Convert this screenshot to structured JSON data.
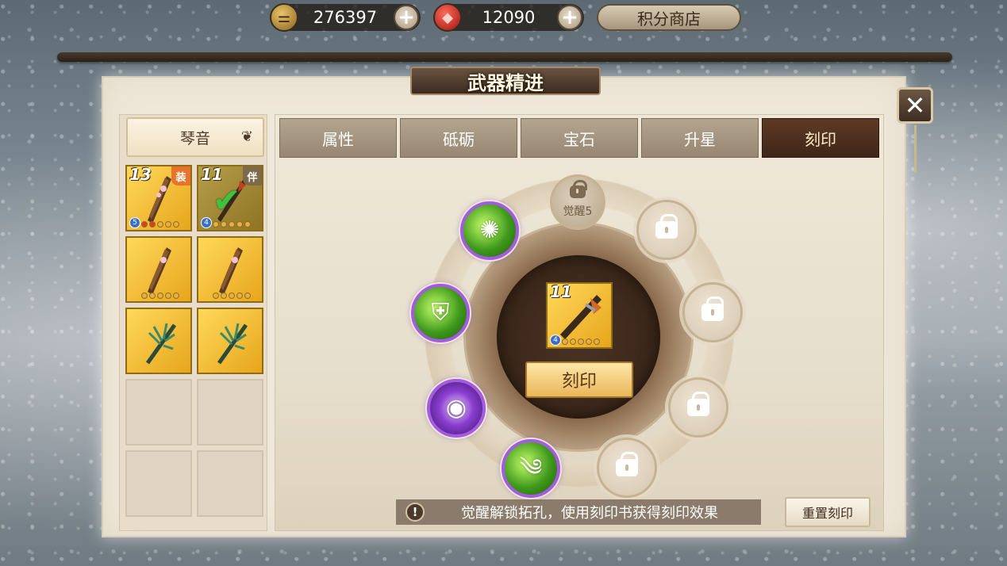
{
  "currency": {
    "gold": {
      "value": "276397",
      "icon": "gold-ingot-icon"
    },
    "gem": {
      "value": "12090",
      "icon": "red-gem-icon"
    },
    "shop_label": "积分商店"
  },
  "window": {
    "title": "武器精进"
  },
  "weapon_filter": {
    "selected": "琴音"
  },
  "weapon_list": [
    {
      "level": "13",
      "tag": "装",
      "stars": 5,
      "grade": "5",
      "type": "guqin"
    },
    {
      "level": "11",
      "tag": "伴",
      "stars": 5,
      "grade": "4",
      "type": "spear",
      "selected": true
    },
    {
      "level": "",
      "tag": "",
      "stars": 5,
      "grade": "",
      "type": "guqin"
    },
    {
      "level": "",
      "tag": "",
      "stars": 5,
      "grade": "",
      "type": "guqin"
    },
    {
      "level": "",
      "tag": "",
      "stars": 0,
      "grade": "",
      "type": "fan"
    },
    {
      "level": "",
      "tag": "",
      "stars": 0,
      "grade": "",
      "type": "fan"
    }
  ],
  "tabs": [
    {
      "label": "属性"
    },
    {
      "label": "砥砺"
    },
    {
      "label": "宝石"
    },
    {
      "label": "升星"
    },
    {
      "label": "刻印",
      "active": true
    }
  ],
  "engrave": {
    "center_item": {
      "level": "11",
      "grade": "4",
      "stars": 5
    },
    "button_label": "刻印",
    "awaken_label": "觉醒5",
    "unlocked_sockets": [
      "green-burst-icon",
      "jade-shield-icon",
      "purple-eye-icon",
      "green-wind-icon"
    ],
    "locked_socket_count": 5
  },
  "hint": {
    "text": "觉醒解锁拓孔，使用刻印书获得刻印效果",
    "icon": "warning-icon"
  },
  "reset_label": "重置刻印",
  "colors": {
    "accent": "#e9b75a",
    "active_tab": "#4b2e1e",
    "socket_ring": "#a45be0"
  }
}
